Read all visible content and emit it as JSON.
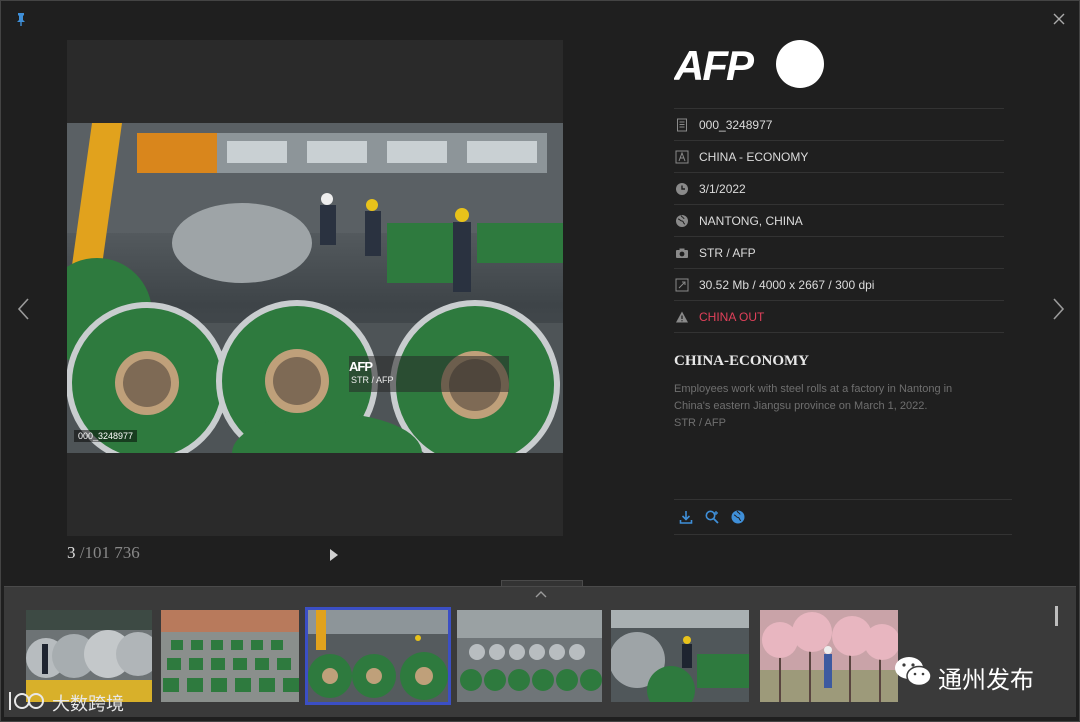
{
  "viewer": {
    "photo_id": "000_3248977",
    "watermark_logo": "AFP",
    "watermark_credit": "STR / AFP"
  },
  "pager": {
    "current": "3",
    "total": "/101 736"
  },
  "agency_logo": "AFP",
  "metadata": [
    {
      "icon": "document-icon",
      "text": "000_3248977"
    },
    {
      "icon": "headline-icon",
      "text": "CHINA - ECONOMY"
    },
    {
      "icon": "clock-icon",
      "text": "3/1/2022"
    },
    {
      "icon": "globe-icon",
      "text": "NANTONG, CHINA"
    },
    {
      "icon": "camera-icon",
      "text": "STR / AFP"
    },
    {
      "icon": "resize-icon",
      "text": "30.52 Mb / 4000 x 2667 / 300 dpi"
    },
    {
      "icon": "warning-icon",
      "text": "CHINA OUT"
    }
  ],
  "title": "CHINA-ECONOMY",
  "caption": {
    "line1": "Employees work with steel rolls at a factory in Nantong in",
    "line2": "China's eastern Jiangsu province on March 1, 2022.",
    "line3": "STR / AFP"
  },
  "actions": [
    "download-icon",
    "zoom-search-icon",
    "globe-icon"
  ],
  "thumbnails": [
    {
      "scene": "steel coils warehouse",
      "selected": false
    },
    {
      "scene": "rows of green coils",
      "selected": false
    },
    {
      "scene": "workers with green coils",
      "selected": true
    },
    {
      "scene": "factory floor coils",
      "selected": false
    },
    {
      "scene": "worker with coils",
      "selected": false
    },
    {
      "scene": "pink blossom trees",
      "selected": false
    }
  ],
  "overlay": {
    "wechat_account": "通州发布",
    "watermark_brand": "大数跨境"
  },
  "colors": {
    "background": "#1f1f1f",
    "warning": "#e0405a",
    "action_icons": "#3f8fd8",
    "selected_outline": "#3b4fc4",
    "coil_green": "#2e7a3e"
  }
}
